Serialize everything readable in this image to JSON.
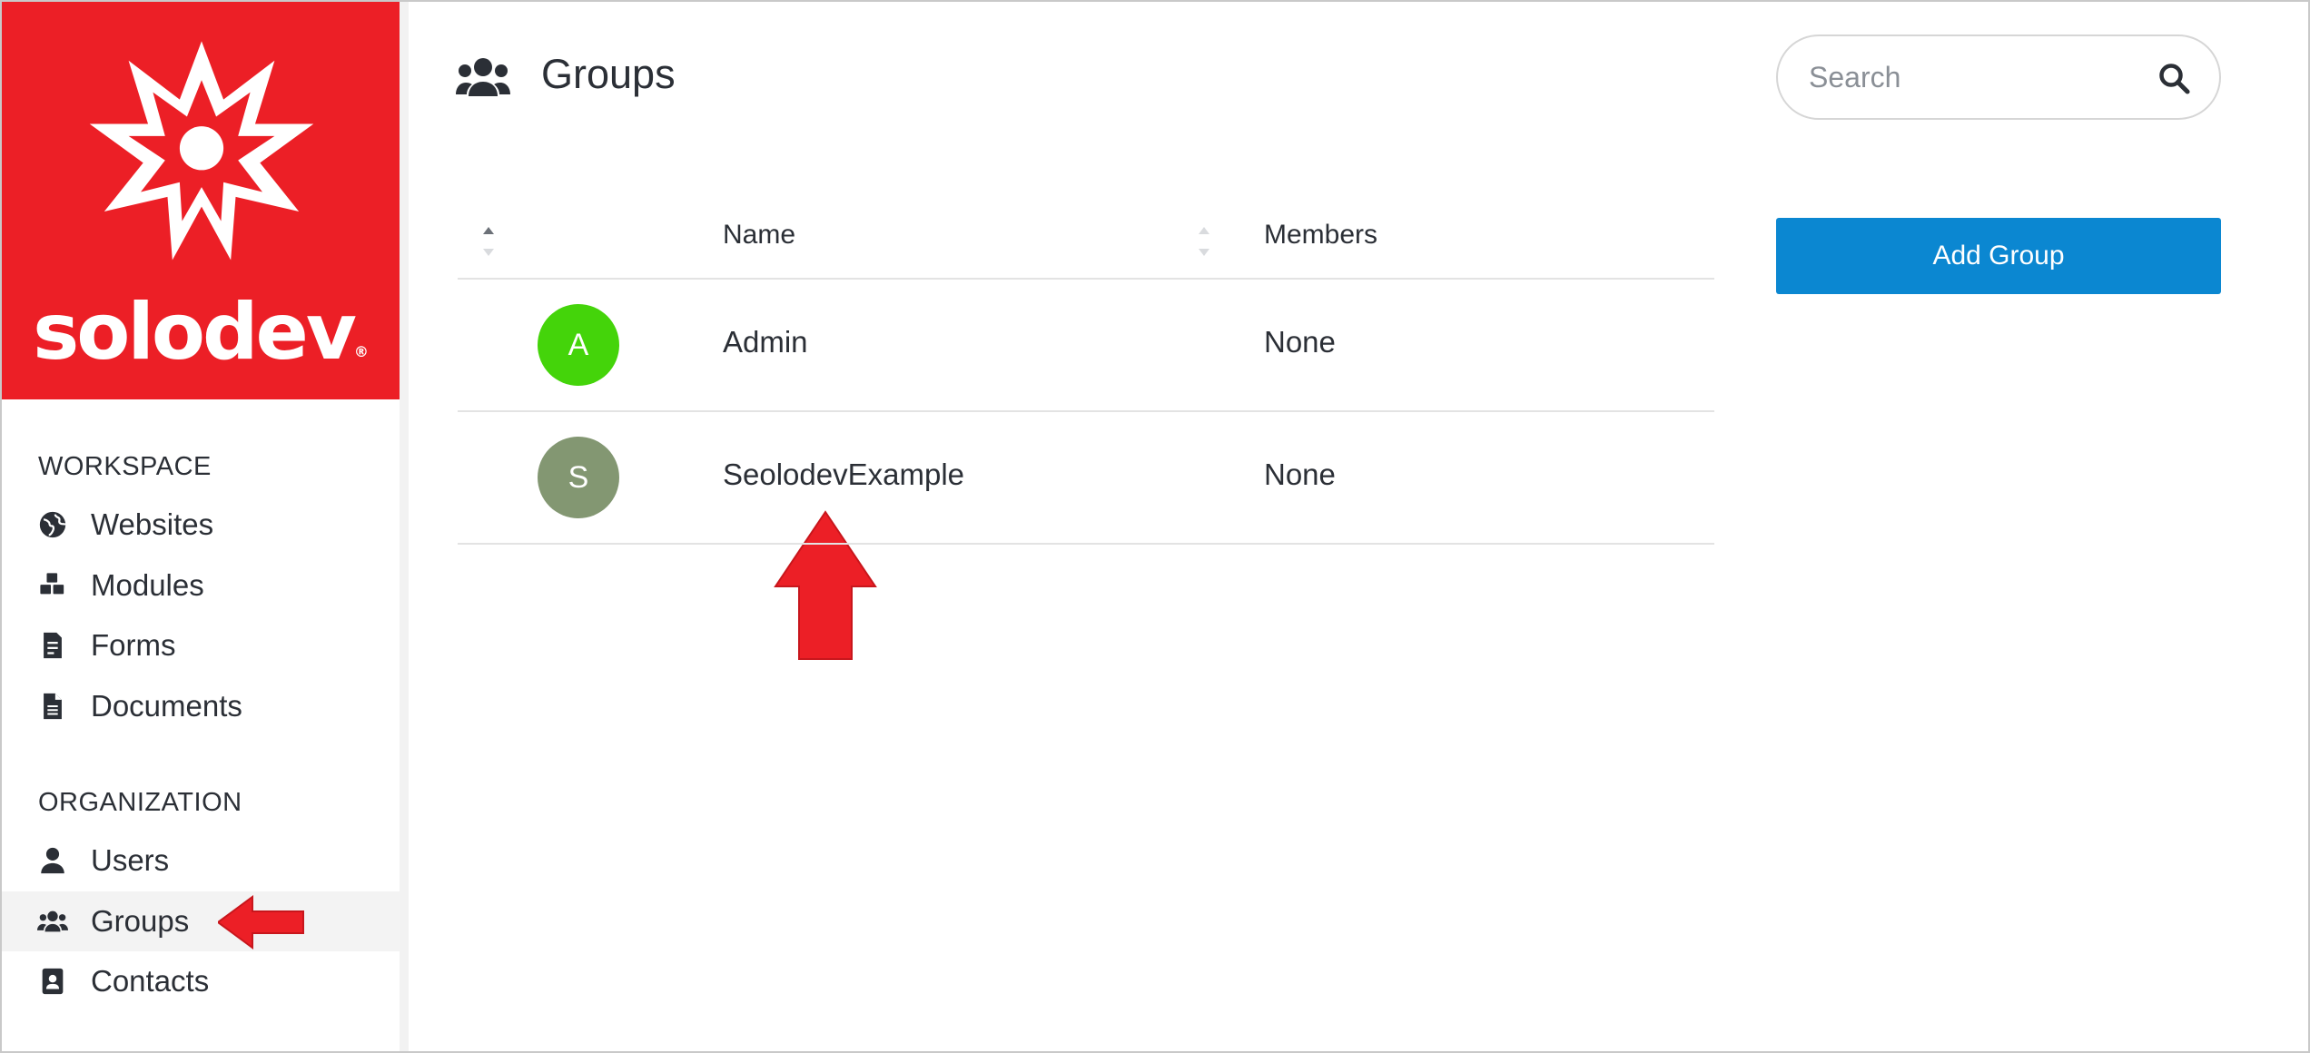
{
  "brand": {
    "name": "solodev",
    "reg_mark": "®",
    "color": "#ec1f26"
  },
  "sidebar": {
    "sections": [
      {
        "title": "WORKSPACE",
        "items": [
          {
            "label": "Websites",
            "icon": "globe-icon"
          },
          {
            "label": "Modules",
            "icon": "cubes-icon"
          },
          {
            "label": "Forms",
            "icon": "form-icon"
          },
          {
            "label": "Documents",
            "icon": "document-icon"
          }
        ]
      },
      {
        "title": "ORGANIZATION",
        "items": [
          {
            "label": "Users",
            "icon": "user-icon"
          },
          {
            "label": "Groups",
            "icon": "users-icon",
            "active": true
          },
          {
            "label": "Contacts",
            "icon": "contact-card-icon"
          }
        ]
      }
    ]
  },
  "header": {
    "title": "Groups",
    "icon": "users-icon"
  },
  "search": {
    "placeholder": "Search",
    "value": ""
  },
  "actions": {
    "add_group_label": "Add Group",
    "accent": "#0b87d1"
  },
  "table": {
    "columns": [
      "Name",
      "Members"
    ],
    "rows": [
      {
        "initial": "A",
        "avatar_color": "#44d40a",
        "name": "Admin",
        "members": "None"
      },
      {
        "initial": "S",
        "avatar_color": "#839772",
        "name": "SeolodevExample",
        "members": "None"
      }
    ]
  },
  "annotations": {
    "arrow_color": "#ec1f26"
  }
}
